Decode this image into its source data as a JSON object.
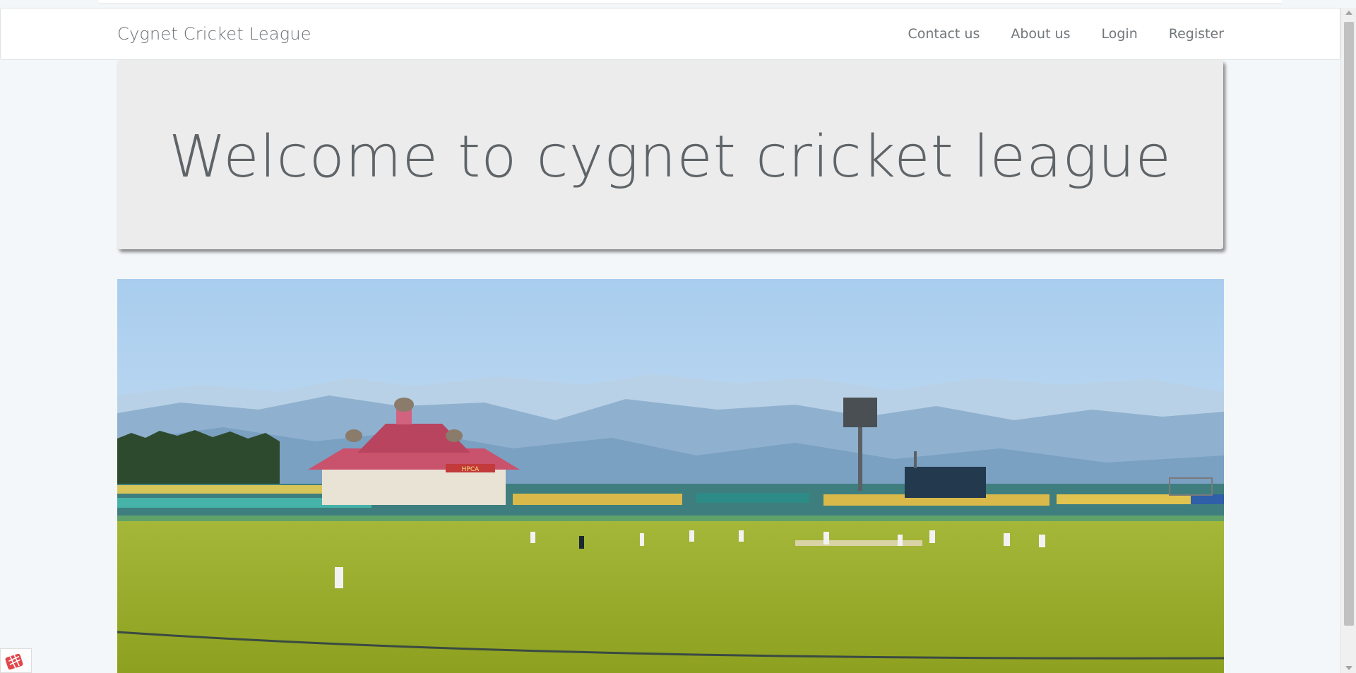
{
  "navbar": {
    "brand": "Cygnet Cricket League",
    "links": [
      "Contact us",
      "About us",
      "Login",
      "Register"
    ]
  },
  "jumbotron": {
    "heading": "Welcome to cygnet cricket league"
  },
  "hero": {
    "scoreboard_text": "HPCA"
  },
  "colors": {
    "page_bg": "#f3f7f9",
    "navbar_bg": "#ffffff",
    "jumbotron_bg": "#ececec",
    "text": "#5f6468",
    "field_green": "#9aab2a",
    "pavilion_roof": "#c9526d"
  },
  "icons": {
    "corner_widget": "app-launcher-icon"
  }
}
